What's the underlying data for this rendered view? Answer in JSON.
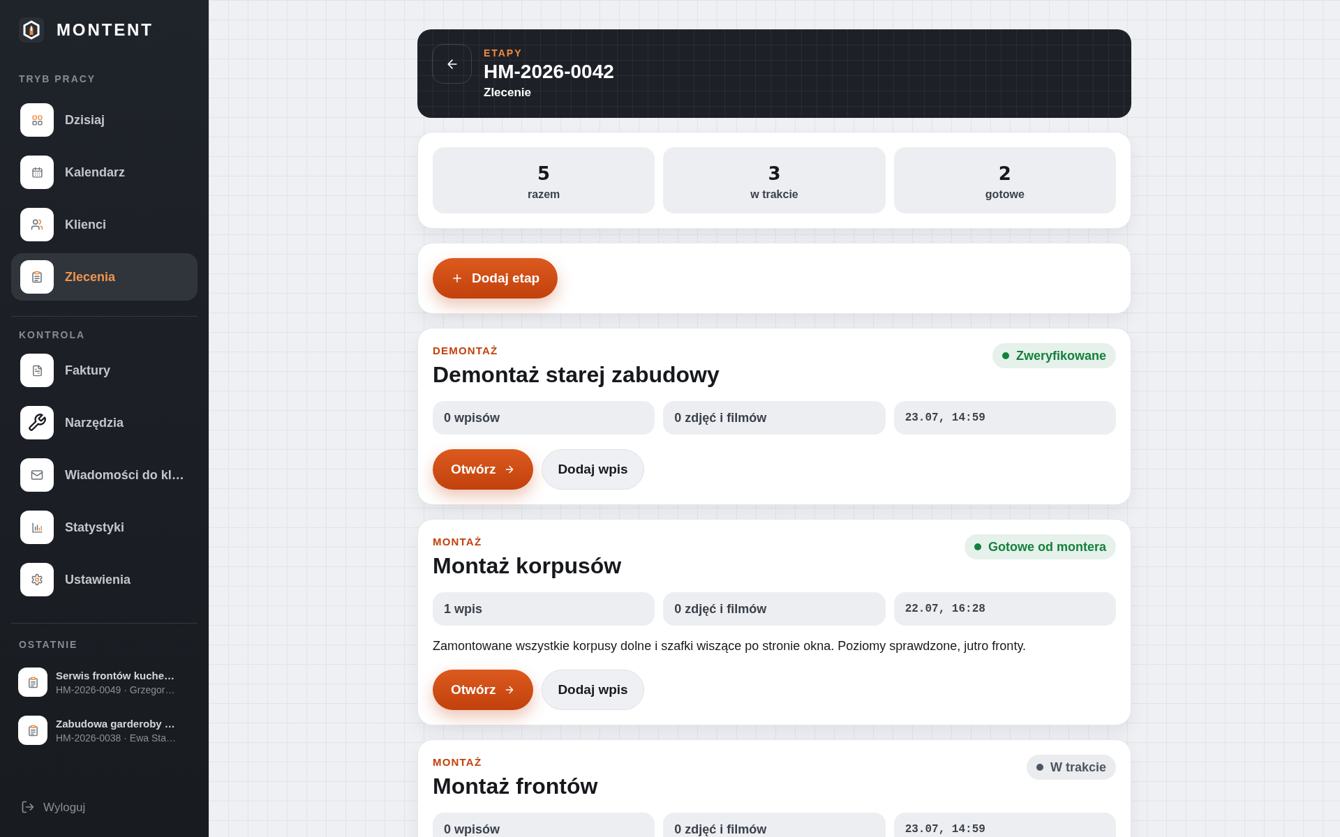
{
  "sidebar": {
    "brand": "MONTENT",
    "sections": [
      {
        "title": "TRYB PRACY",
        "items": [
          {
            "label": "Dzisiaj",
            "selected": false
          },
          {
            "label": "Kalendarz",
            "selected": false
          },
          {
            "label": "Klienci",
            "selected": false
          },
          {
            "label": "Zlecenia",
            "selected": true
          }
        ]
      },
      {
        "title": "KONTROLA",
        "items": [
          {
            "label": "Faktury",
            "selected": false
          },
          {
            "label": "Narzędzia",
            "selected": false
          },
          {
            "label": "Wiadomości do kl…",
            "selected": false
          },
          {
            "label": "Statystyki",
            "selected": false
          },
          {
            "label": "Ustawienia",
            "selected": false
          }
        ]
      }
    ],
    "recent": {
      "title": "OSTATNIE",
      "items": [
        {
          "title": "Serwis frontów kuche…",
          "subtitle": "HM-2026-0049 · Grzegor…"
        },
        {
          "title": "Zabudowa garderoby …",
          "subtitle": "HM-2026-0038 · Ewa Sta…"
        }
      ]
    },
    "logout": "Wyloguj"
  },
  "header": {
    "eyebrow": "ETAPY",
    "title": "HM-2026-0042",
    "subtitle": "Zlecenie"
  },
  "stats": [
    {
      "value": "5",
      "label": "razem"
    },
    {
      "value": "3",
      "label": "w trakcie"
    },
    {
      "value": "2",
      "label": "gotowe"
    }
  ],
  "add_stage_button": "Dodaj etap",
  "stages": [
    {
      "category": "DEMONTAŻ",
      "title": "Demontaż starej zabudowy",
      "status": {
        "label": "Zweryfikowane",
        "color": "#15803d"
      },
      "entries": "0 wpisów",
      "media": "0 zdjęć i filmów",
      "time": "23.07, 14:59",
      "open_button": "Otwórz",
      "add_entry_button": "Dodaj wpis"
    },
    {
      "category": "MONTAŻ",
      "title": "Montaż korpusów",
      "status": {
        "label": "Gotowe od montera",
        "color": "#15803d"
      },
      "entries": "1 wpis",
      "media": "0 zdjęć i filmów",
      "time": "22.07, 16:28",
      "note": "Zamontowane wszystkie korpusy dolne i szafki wiszące po stronie okna. Poziomy sprawdzone, jutro fronty.",
      "open_button": "Otwórz",
      "add_entry_button": "Dodaj wpis"
    },
    {
      "category": "MONTAŻ",
      "title": "Montaż frontów",
      "status": {
        "label": "W trakcie",
        "color": "#4b5563"
      },
      "entries": "0 wpisów",
      "media": "0 zdjęć i filmów",
      "time": "23.07, 14:59"
    }
  ]
}
